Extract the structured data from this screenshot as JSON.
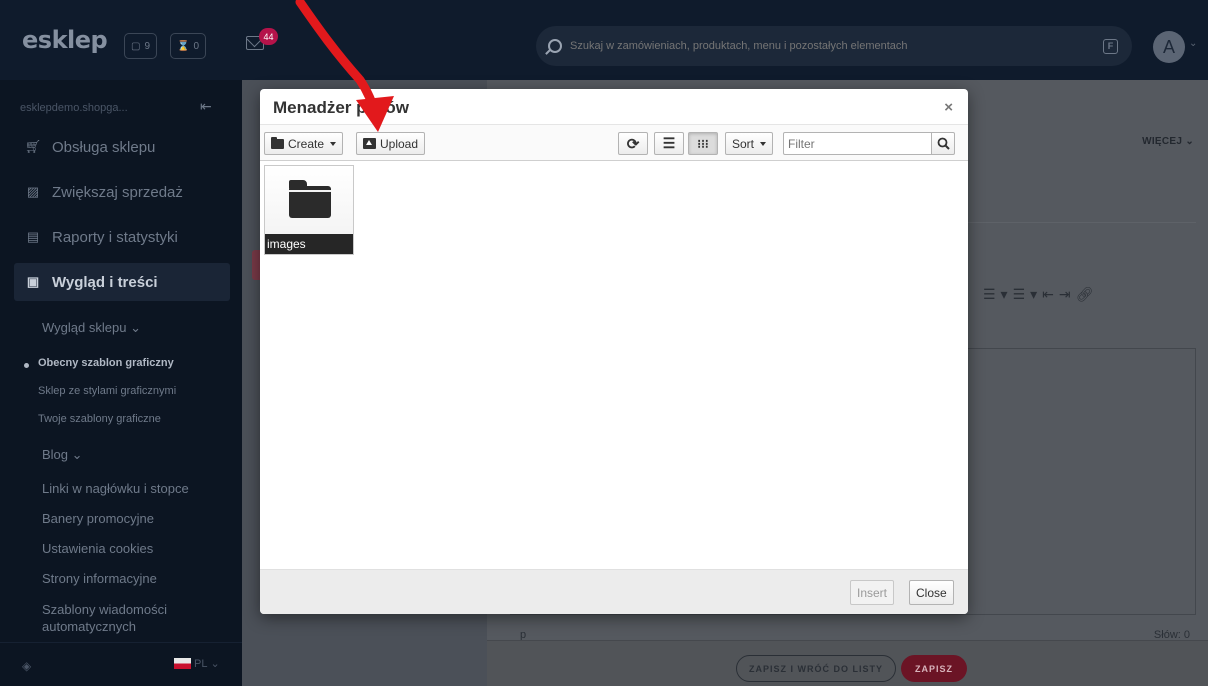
{
  "topbar": {
    "logo": "esklep",
    "orders_count": "9",
    "pending_count": "0",
    "messages_count": "44",
    "search_placeholder": "Szukaj w zamówieniach, produktach, menu i pozostałych elementach",
    "search_shortcut": "F",
    "avatar_letter": "A"
  },
  "sidebar": {
    "domain": "esklepdemo.shopga...",
    "items": [
      {
        "label": "Obsługa sklepu",
        "icon": "cart-icon"
      },
      {
        "label": "Zwiększaj sprzedaż",
        "icon": "chart-icon"
      },
      {
        "label": "Raporty i statystyki",
        "icon": "report-icon"
      },
      {
        "label": "Wygląd i treści",
        "icon": "image-icon"
      }
    ],
    "sub_appearance": "Wygląd sklepu",
    "sub_small": [
      "Obecny szablon graficzny",
      "Sklep ze stylami graficznymi",
      "Twoje szablony graficzne"
    ],
    "sub_blog": "Blog",
    "sub_items": [
      "Linki w nagłówku i stopce",
      "Banery promocyjne",
      "Ustawienia cookies",
      "Strony informacyjne",
      "Szablony wiadomości automatycznych"
    ],
    "language": "PL"
  },
  "main": {
    "more": "WIĘCEJ",
    "editor_tag": "p",
    "word_count": "Słów: 0",
    "save_back": "ZAPISZ I WRÓĆ DO LISTY",
    "save": "ZAPISZ"
  },
  "modal": {
    "title": "Menadżer plików",
    "close_glyph": "×",
    "toolbar": {
      "create": "Create",
      "upload": "Upload",
      "sort": "Sort",
      "filter_placeholder": "Filter"
    },
    "files": [
      {
        "name": "images",
        "type": "folder"
      }
    ],
    "footer": {
      "insert": "Insert",
      "close": "Close"
    }
  },
  "colors": {
    "annotation_arrow": "#e2191c",
    "topbar_bg": "#0f1b2c",
    "sidebar_bg": "#0c1522",
    "save_button": "#6b1425"
  }
}
